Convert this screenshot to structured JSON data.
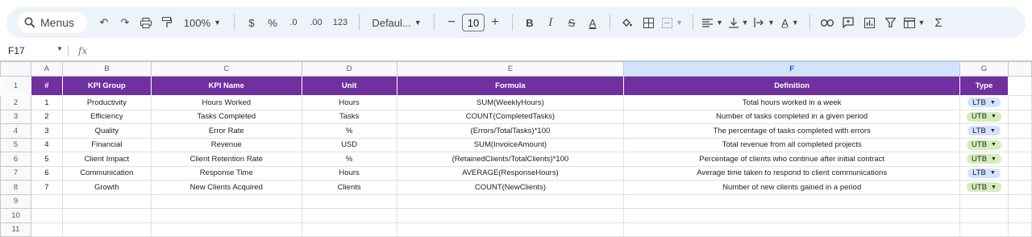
{
  "toolbar": {
    "search_label": "Menus",
    "zoom": "100%",
    "currency": "$",
    "percent": "%",
    "decrease_decimal": ".0",
    "increase_decimal": ".00",
    "number_format": "123",
    "font": "Defaul...",
    "font_size": "10",
    "bold": "B",
    "italic": "I",
    "strike": "S",
    "text_color": "A",
    "sum": "Σ"
  },
  "formula_bar": {
    "cell_ref": "F17",
    "fx": "fx",
    "content": ""
  },
  "columns": [
    "A",
    "B",
    "C",
    "D",
    "E",
    "F",
    "G"
  ],
  "selected_column": "F",
  "header_row": [
    "#",
    "KPI Group",
    "KPI Name",
    "Unit",
    "Formula",
    "Definition",
    "Type"
  ],
  "rows": [
    [
      "1",
      "Productivity",
      "Hours Worked",
      "Hours",
      "SUM(WeeklyHours)",
      "Total hours worked in a week",
      "LTB"
    ],
    [
      "2",
      "Efficiency",
      "Tasks Completed",
      "Tasks",
      "COUNT(CompletedTasks)",
      "Number of tasks completed in a given period",
      "UTB"
    ],
    [
      "3",
      "Quality",
      "Error Rate",
      "%",
      "(Errors/TotalTasks)*100",
      "The percentage of tasks completed with errors",
      "LTB"
    ],
    [
      "4",
      "Financial",
      "Revenue",
      "USD",
      "SUM(InvoiceAmount)",
      "Total revenue from all completed projects",
      "UTB"
    ],
    [
      "5",
      "Client Impact",
      "Client Retention Rate",
      "%",
      "(RetainedClients/TotalClients)*100",
      "Percentage of clients who continue after initial contract",
      "UTB"
    ],
    [
      "6",
      "Communication",
      "Response Time",
      "Hours",
      "AVERAGE(ResponseHours)",
      "Average time taken to respond to client communications",
      "LTB"
    ],
    [
      "7",
      "Growth",
      "New Clients Acquired",
      "Clients",
      "COUNT(NewClients)",
      "Number of new clients gained in a period",
      "UTB"
    ]
  ],
  "empty_row_numbers": [
    "9",
    "10",
    "11"
  ],
  "colors": {
    "header_bg": "#7030a0",
    "ltb_chip": "#d3e3fd",
    "utb_chip": "#d4edbc"
  }
}
